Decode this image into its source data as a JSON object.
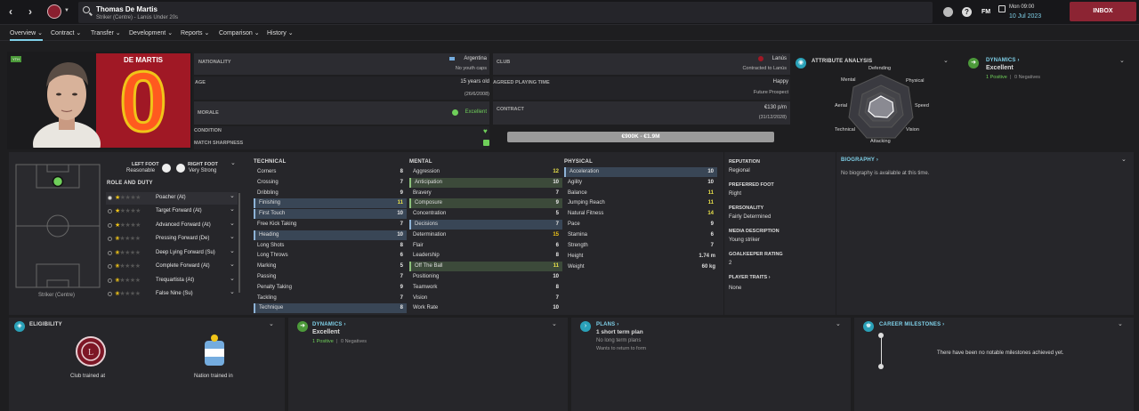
{
  "header": {
    "player_name": "Thomas De Martis",
    "player_subtitle": "Striker (Centre) - Lanús Under 20s",
    "time": "Mon 09:00",
    "date": "10 Jul 2023",
    "fm_label": "FM",
    "inbox_label": "INBOX",
    "help_glyph": "?",
    "back_glyph": "‹",
    "forward_glyph": "›",
    "dropdown_glyph": "⌄"
  },
  "tabs": [
    "Overview",
    "Contract",
    "Transfer",
    "Development",
    "Reports",
    "Comparison",
    "History"
  ],
  "profile": {
    "tag": "YTH",
    "surname": "DE MARTIS",
    "squad_number": "0",
    "nationality_label": "NATIONALITY",
    "nationality": "Argentina",
    "youth_caps": "No youth caps",
    "club_label": "CLUB",
    "club": "Lanús",
    "club_status": "Contracted to Lanús",
    "age_label": "AGE",
    "age": "15 years old",
    "dob": "(26/6/2008)",
    "agreed_playing_time_label": "AGREED PLAYING TIME",
    "playing_time": "Happy",
    "playing_time_sub": "Future Prospect",
    "morale_label": "MORALE",
    "morale": "Excellent",
    "contract_label": "CONTRACT",
    "wage": "€130 p/m",
    "contract_end": "(31/12/2028)",
    "condition_label": "CONDITION",
    "match_sharpness_label": "MATCH SHARPNESS",
    "value_range": "€900K - €1.9M"
  },
  "attribute_analysis": {
    "title": "ATTRIBUTE ANALYSIS",
    "axes": [
      "Defending",
      "Physical",
      "Speed",
      "Vision",
      "Attacking",
      "Technical",
      "Aerial",
      "Mental"
    ]
  },
  "dynamics": {
    "title": "DYNAMICS",
    "value": "Excellent",
    "positive": "1 Positive",
    "negative": "0 Negatives",
    "separator": "|"
  },
  "feet": {
    "left_label": "LEFT FOOT",
    "left_value": "Reasonable",
    "right_label": "RIGHT FOOT",
    "right_value": "Very Strong"
  },
  "role_duty": {
    "title": "ROLE AND DUTY",
    "position_caption": "Striker (Centre)",
    "roles": [
      "Poacher (At)",
      "Target Forward (At)",
      "Advanced Forward (At)",
      "Pressing Forward (De)",
      "Deep Lying Forward (Su)",
      "Complete Forward (At)",
      "Trequartista (At)",
      "False Nine (Su)"
    ]
  },
  "technical": {
    "title": "TECHNICAL",
    "attrs": [
      {
        "name": "Corners",
        "value": "8"
      },
      {
        "name": "Crossing",
        "value": "7"
      },
      {
        "name": "Dribbling",
        "value": "9"
      },
      {
        "name": "Finishing",
        "value": "11"
      },
      {
        "name": "First Touch",
        "value": "10"
      },
      {
        "name": "Free Kick Taking",
        "value": "7"
      },
      {
        "name": "Heading",
        "value": "10"
      },
      {
        "name": "Long Shots",
        "value": "8"
      },
      {
        "name": "Long Throws",
        "value": "6"
      },
      {
        "name": "Marking",
        "value": "5"
      },
      {
        "name": "Passing",
        "value": "7"
      },
      {
        "name": "Penalty Taking",
        "value": "9"
      },
      {
        "name": "Tackling",
        "value": "7"
      },
      {
        "name": "Technique",
        "value": "8"
      }
    ]
  },
  "mental": {
    "title": "MENTAL",
    "attrs": [
      {
        "name": "Aggression",
        "value": "12"
      },
      {
        "name": "Anticipation",
        "value": "10"
      },
      {
        "name": "Bravery",
        "value": "7"
      },
      {
        "name": "Composure",
        "value": "9"
      },
      {
        "name": "Concentration",
        "value": "5"
      },
      {
        "name": "Decisions",
        "value": "7"
      },
      {
        "name": "Determination",
        "value": "15"
      },
      {
        "name": "Flair",
        "value": "6"
      },
      {
        "name": "Leadership",
        "value": "8"
      },
      {
        "name": "Off The Ball",
        "value": "11"
      },
      {
        "name": "Positioning",
        "value": "10"
      },
      {
        "name": "Teamwork",
        "value": "8"
      },
      {
        "name": "Vision",
        "value": "7"
      },
      {
        "name": "Work Rate",
        "value": "10"
      }
    ]
  },
  "physical": {
    "title": "PHYSICAL",
    "attrs": [
      {
        "name": "Acceleration",
        "value": "10"
      },
      {
        "name": "Agility",
        "value": "10"
      },
      {
        "name": "Balance",
        "value": "11"
      },
      {
        "name": "Jumping Reach",
        "value": "11"
      },
      {
        "name": "Natural Fitness",
        "value": "14"
      },
      {
        "name": "Pace",
        "value": "9"
      },
      {
        "name": "Stamina",
        "value": "6"
      },
      {
        "name": "Strength",
        "value": "7"
      }
    ],
    "height_label": "Height",
    "height": "1.74 m",
    "weight_label": "Weight",
    "weight": "60 kg"
  },
  "info": {
    "reputation_label": "REPUTATION",
    "reputation": "Regional",
    "preferred_foot_label": "PREFERRED FOOT",
    "preferred_foot": "Right",
    "personality_label": "PERSONALITY",
    "personality": "Fairly Determined",
    "media_label": "MEDIA DESCRIPTION",
    "media": "Young striker",
    "gk_label": "GOALKEEPER RATING",
    "gk": "2",
    "traits_label": "PLAYER TRAITS",
    "traits": "None"
  },
  "biography": {
    "title": "BIOGRAPHY",
    "text": "No biography is available at this time."
  },
  "eligibility": {
    "title": "ELIGIBILITY",
    "club_caption": "Club trained at",
    "nation_caption": "Nation trained in"
  },
  "plans": {
    "title": "PLANS",
    "line1": "1 short term plan",
    "line2": "No long term plans",
    "line3": "Wants to return to form"
  },
  "milestones": {
    "title": "CAREER MILESTONES",
    "text": "There have been no notable milestones achieved yet."
  },
  "colors": {
    "accent": "#7fd0e8",
    "brand": "#8c2433",
    "positive": "#6fcf5a",
    "highlight_blue": "#394656",
    "highlight_green": "#3c4a3a"
  }
}
